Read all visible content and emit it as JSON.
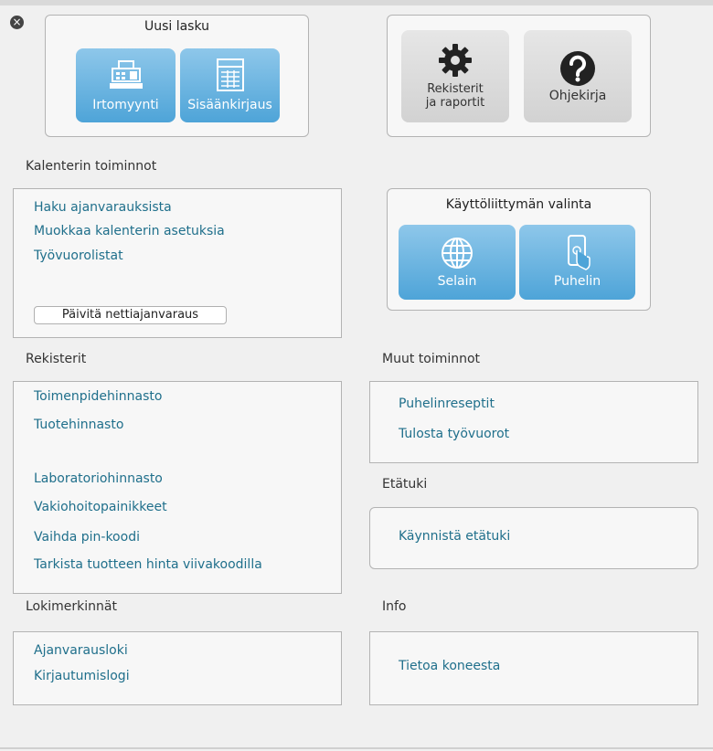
{
  "new_invoice": {
    "title": "Uusi lasku",
    "buttons": [
      {
        "label": "Irtomyynti",
        "icon": "cash-register-icon"
      },
      {
        "label": "Sisäänkirjaus",
        "icon": "ledger-icon"
      }
    ]
  },
  "tools": {
    "registers_reports_line1": "Rekisterit",
    "registers_reports_line2": "ja raportit",
    "manual_label": "Ohjekirja"
  },
  "calendar": {
    "heading": "Kalenterin toiminnot",
    "links": [
      "Haku ajanvarauksista",
      "Muokkaa kalenterin asetuksia",
      "Työvuorolistat"
    ],
    "update_button": "Päivitä nettiajanvaraus"
  },
  "ui_choice": {
    "title": "Käyttöliittymän valinta",
    "browser_label": "Selain",
    "phone_label": "Puhelin"
  },
  "registers": {
    "heading": "Rekisterit",
    "links": [
      "Toimenpidehinnasto",
      "Tuotehinnasto",
      "Laboratoriohinnasto",
      "Vakiohoitopainikkeet",
      "Vaihda pin-koodi",
      "Tarkista tuotteen hinta viivakoodilla"
    ]
  },
  "other": {
    "heading": "Muut toiminnot",
    "links": [
      "Puhelinreseptit",
      "Tulosta työvuorot"
    ]
  },
  "remote": {
    "heading": "Etätuki",
    "link": "Käynnistä etätuki"
  },
  "logs": {
    "heading": "Lokimerkinnät",
    "links": [
      "Ajanvarausloki",
      "Kirjautumislogi"
    ]
  },
  "info": {
    "heading": "Info",
    "link": "Tietoa koneesta"
  },
  "icons": {
    "close": "×"
  },
  "colors": {
    "link": "#1f6f8b",
    "accent_button": "#4ea4d8",
    "panel_border": "#b3b3b3"
  }
}
